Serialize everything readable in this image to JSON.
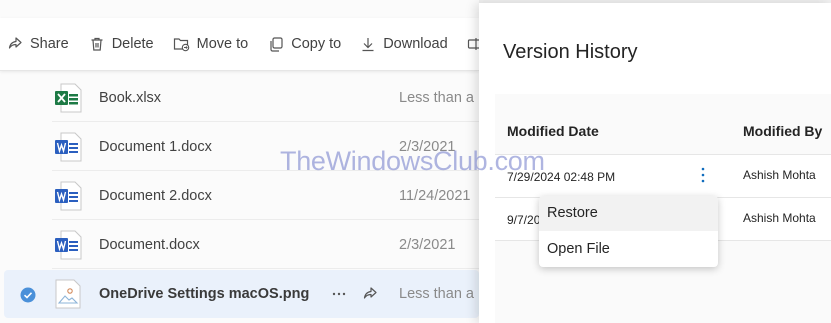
{
  "toolbar": {
    "share": "Share",
    "delete": "Delete",
    "move_to": "Move to",
    "copy_to": "Copy to",
    "download": "Download"
  },
  "files": [
    {
      "name": "Book.xlsx",
      "modified": "Less than a m",
      "type": "excel"
    },
    {
      "name": "Document 1.docx",
      "modified": "2/3/2021",
      "type": "word"
    },
    {
      "name": "Document 2.docx",
      "modified": "11/24/2021",
      "type": "word"
    },
    {
      "name": "Document.docx",
      "modified": "2/3/2021",
      "type": "word"
    },
    {
      "name": "OneDrive Settings macOS.png",
      "modified": "Less than a m",
      "type": "image",
      "selected": true
    }
  ],
  "panel": {
    "title": "Version History",
    "col_modified_date": "Modified Date",
    "col_modified_by": "Modified By",
    "versions": [
      {
        "date": "7/29/2024 02:48 PM",
        "by": "Ashish Mohta"
      },
      {
        "date": "9/7/20",
        "by": "Ashish Mohta"
      }
    ]
  },
  "context_menu": {
    "restore": "Restore",
    "open_file": "Open File"
  },
  "watermark": "TheWindowsClub.com",
  "colors": {
    "selected_row": "#eaf1fb",
    "check_accent": "#4a90d9",
    "more_icon": "#0f6cbd",
    "excel": "#1d7a45",
    "word": "#2b5fbf"
  }
}
